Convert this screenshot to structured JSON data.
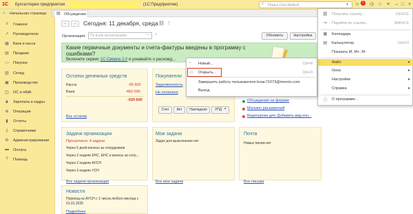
{
  "titlebar": {
    "logo": "1С",
    "app_name": "Бухгалтерия предприятия",
    "edition": "(1С:Предприятие)",
    "search_placeholder": "Поиск Ctrl+Shift+F",
    "notification_count": "1"
  },
  "tabs": [
    {
      "label": "Начальная страница"
    },
    {
      "label": "Обсуждения"
    }
  ],
  "sidebar": {
    "items": [
      {
        "label": "Главное",
        "icon": "menu-icon"
      },
      {
        "label": "Руководителю",
        "icon": "chart-icon"
      },
      {
        "label": "Банк и касса",
        "icon": "bank-icon"
      },
      {
        "label": "Продажи",
        "icon": "cart-icon"
      },
      {
        "label": "Покупки",
        "icon": "basket-icon"
      },
      {
        "label": "Склад",
        "icon": "warehouse-icon"
      },
      {
        "label": "Производство",
        "icon": "factory-icon"
      },
      {
        "label": "ОС и НМА",
        "icon": "assets-icon"
      },
      {
        "label": "Зарплата и кадры",
        "icon": "people-icon"
      },
      {
        "label": "Операции",
        "icon": "operations-icon"
      },
      {
        "label": "Отчеты",
        "icon": "reports-icon"
      },
      {
        "label": "Справочники",
        "icon": "book-icon"
      },
      {
        "label": "Администрирование",
        "icon": "gear-icon"
      },
      {
        "label": "Оплата",
        "icon": "payment-icon"
      },
      {
        "label": "Помощь",
        "icon": "help-icon"
      }
    ]
  },
  "main": {
    "title": "Сегодня: 11 декабря, среда",
    "org_label": "Организация:",
    "org_placeholder": "По всем организациям",
    "refresh_label": "Обновить",
    "settings_label": "Настройка"
  },
  "banner": {
    "title": "Какие первичные документы и счета-фактуры введены в программу с ошибками?",
    "text_before": "Включите сервис ",
    "link": "1С:Сверка 2.0",
    "text_after": " и узнавайте о расхожд..."
  },
  "cash_panel": {
    "title": "Остатки денежных средств",
    "rows": [
      {
        "label": "Касса:",
        "value": "-69 600"
      },
      {
        "label": "Банк:",
        "value": "-460 000"
      }
    ],
    "total": "-529 600",
    "link": "Все остатки"
  },
  "buyers_panel": {
    "title": "Покупатели",
    "debt_link": "Задолженность",
    "unpaid_link": "Не оплачено",
    "tabs": [
      "Счет",
      "Акт",
      "Накладная",
      "УПД"
    ]
  },
  "discussions": {
    "items": [
      "Обсуждения на форуме",
      "Магазин расширений",
      "Видеоуроки для 'Добавить вид кон..."
    ]
  },
  "tasks_panel": {
    "title": "Задачи организации",
    "overdue": "Просрочено: 4 задачи",
    "items": [
      "Через 5 дней взносы за сотрудников",
      "Через 2 недели ЕНС, ЕНС и взносы за сотр...",
      "Через 2 недели АУСН",
      "Через 3 недели УСН"
    ],
    "link": "Все задачи организации"
  },
  "my_tasks": {
    "title": "Мои задачи",
    "empty": "Задач для выполнения нет",
    "link": "Все мои задачи"
  },
  "mail": {
    "title": "Почта",
    "empty": "Новых писем нет",
    "link": "Все письма"
  },
  "news": {
    "title": "Новости",
    "text": "Переход на АУСН с 1 числа любого месяца с 01.01.2025",
    "link": "Подробнее"
  },
  "main_menu": {
    "items": [
      {
        "label": "Получить ссылку...",
        "shortcut": "Ctrl+F11",
        "disabled": true
      },
      {
        "label": "Перейти по ссылке...",
        "shortcut": "Shift+F11",
        "disabled": true
      },
      {
        "label": "Календарь",
        "shortcut": ""
      },
      {
        "label": "Калькулятор",
        "shortcut": "Ctrl+F2"
      },
      {
        "label": "Показать М, М+, М-",
        "shortcut": ""
      },
      {
        "label": "Файл",
        "shortcut": "",
        "active": true
      },
      {
        "label": "Окна",
        "shortcut": ""
      },
      {
        "label": "Настройки",
        "shortcut": ""
      },
      {
        "label": "Справка",
        "shortcut": ""
      },
      {
        "label": "О программе...",
        "shortcut": ""
      }
    ]
  },
  "file_menu": {
    "items": [
      {
        "label": "Новый...",
        "shortcut": "Ctrl+N"
      },
      {
        "label": "Открыть...",
        "shortcut": "Ctrl+O"
      },
      {
        "label": "Завершить работу пользователя lexac71073@merotx.com",
        "shortcut": ""
      },
      {
        "label": "Выход",
        "shortcut": ""
      }
    ]
  },
  "colors": {
    "sidebar_bg": "#fbe99a",
    "banner_bg": "#c9ecc0",
    "link": "#2a4fb8",
    "panel_title": "#2c6e9e",
    "menu_active": "#f7dd63",
    "highlight_box": "#d8382a"
  }
}
